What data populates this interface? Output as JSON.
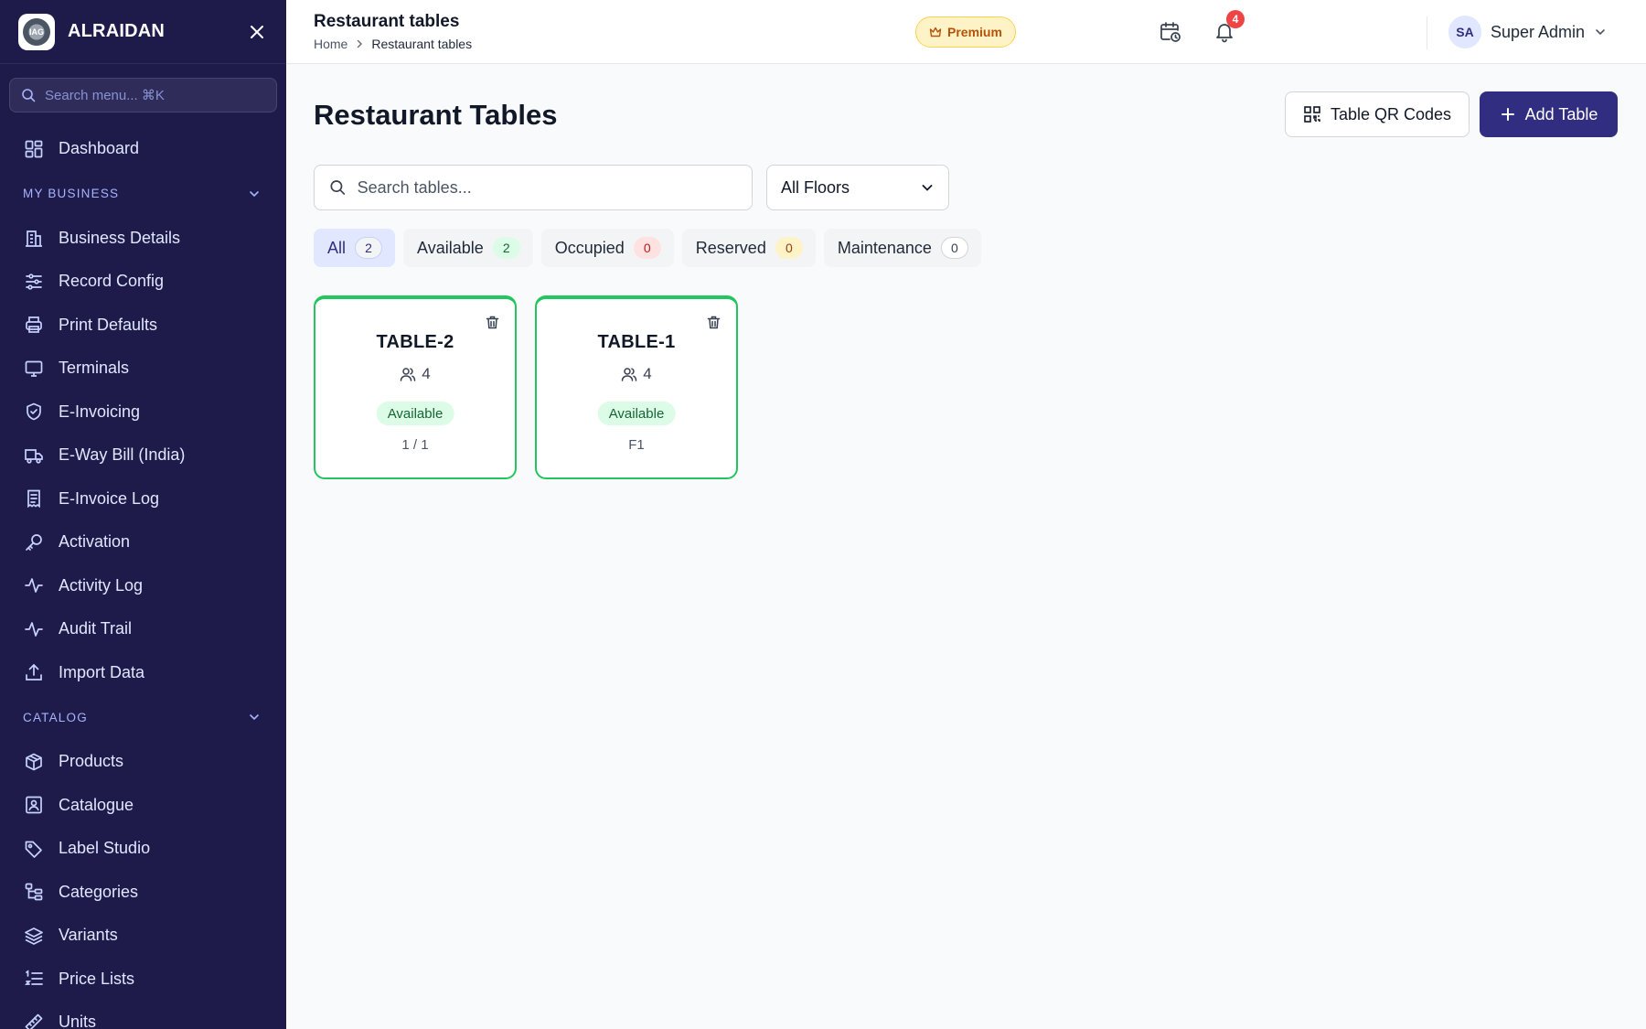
{
  "brand": {
    "name": "ALRAIDAN",
    "logo_text": "IAG"
  },
  "sidebar": {
    "search_placeholder": "Search menu... ⌘K",
    "dashboard": {
      "label": "Dashboard",
      "icon": "grid-icon"
    },
    "sections": [
      {
        "title": "MY BUSINESS",
        "items": [
          {
            "label": "Business Details",
            "icon": "building-icon"
          },
          {
            "label": "Record Config",
            "icon": "sliders-icon"
          },
          {
            "label": "Print Defaults",
            "icon": "printer-icon"
          },
          {
            "label": "Terminals",
            "icon": "monitor-icon"
          },
          {
            "label": "E-Invoicing",
            "icon": "shield-check-icon"
          },
          {
            "label": "E-Way Bill (India)",
            "icon": "truck-icon"
          },
          {
            "label": "E-Invoice Log",
            "icon": "receipt-icon"
          },
          {
            "label": "Activation",
            "icon": "key-icon"
          },
          {
            "label": "Activity Log",
            "icon": "activity-icon"
          },
          {
            "label": "Audit Trail",
            "icon": "activity-icon"
          },
          {
            "label": "Import Data",
            "icon": "upload-icon"
          }
        ]
      },
      {
        "title": "CATALOG",
        "items": [
          {
            "label": "Products",
            "icon": "package-icon"
          },
          {
            "label": "Catalogue",
            "icon": "image-icon"
          },
          {
            "label": "Label Studio",
            "icon": "tag-icon"
          },
          {
            "label": "Categories",
            "icon": "tree-icon"
          },
          {
            "label": "Variants",
            "icon": "layers-icon"
          },
          {
            "label": "Price Lists",
            "icon": "list-ordered-icon"
          },
          {
            "label": "Units",
            "icon": "ruler-icon"
          }
        ]
      }
    ]
  },
  "topbar": {
    "title": "Restaurant tables",
    "breadcrumb": {
      "home": "Home",
      "current": "Restaurant tables"
    },
    "premium_label": "Premium",
    "notification_count": "4",
    "user": {
      "initials": "SA",
      "name": "Super Admin"
    }
  },
  "main": {
    "title": "Restaurant Tables",
    "qr_button": "Table QR Codes",
    "add_button": "Add Table",
    "search_placeholder": "Search tables...",
    "floor_select": "All Floors",
    "filters": [
      {
        "label": "All",
        "count": "2"
      },
      {
        "label": "Available",
        "count": "2"
      },
      {
        "label": "Occupied",
        "count": "0"
      },
      {
        "label": "Reserved",
        "count": "0"
      },
      {
        "label": "Maintenance",
        "count": "0"
      }
    ],
    "tables": [
      {
        "name": "TABLE-2",
        "seats": "4",
        "status": "Available",
        "location": "1 / 1"
      },
      {
        "name": "TABLE-1",
        "seats": "4",
        "status": "Available",
        "location": "F1"
      }
    ]
  },
  "colors": {
    "sidebar_bg": "#1e1b4b",
    "primary": "#312e81",
    "available_green": "#22c55e",
    "notification_red": "#ef4444",
    "premium_amber": "#b45309"
  }
}
